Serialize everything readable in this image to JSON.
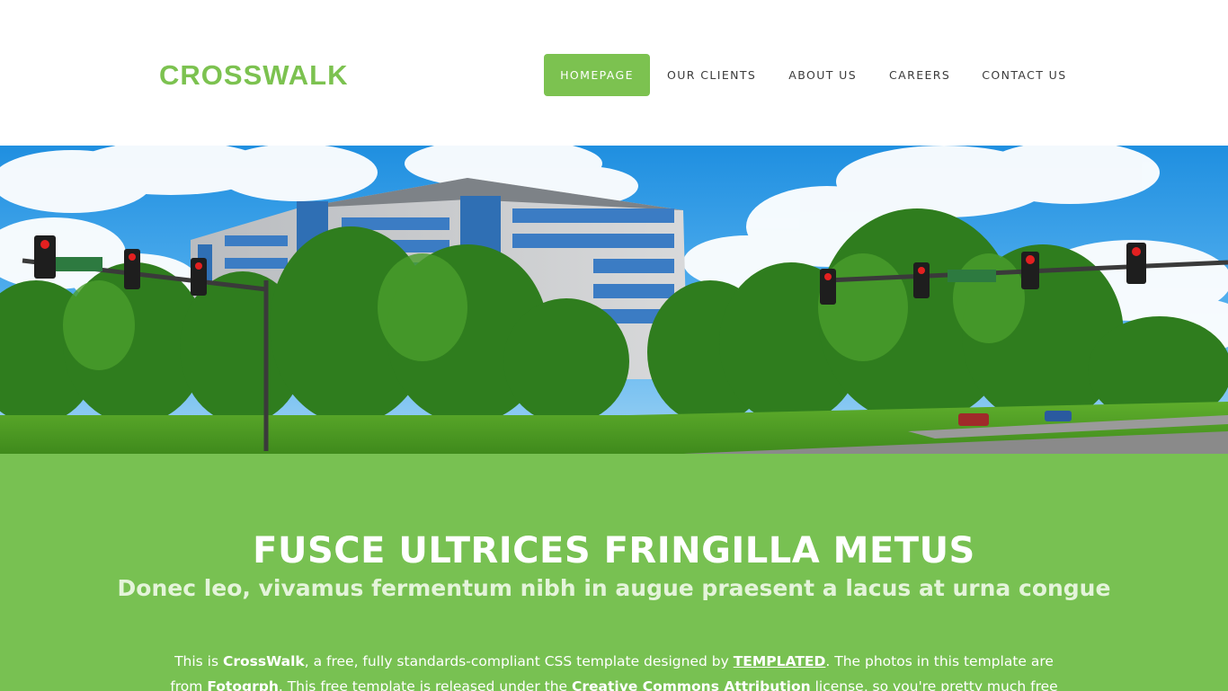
{
  "header": {
    "logo": "CROSSWALK",
    "nav": [
      {
        "label": "HOMEPAGE",
        "active": true
      },
      {
        "label": "OUR CLIENTS",
        "active": false
      },
      {
        "label": "ABOUT US",
        "active": false
      },
      {
        "label": "CAREERS",
        "active": false
      },
      {
        "label": "CONTACT US",
        "active": false
      }
    ]
  },
  "colors": {
    "accent": "#7cc250",
    "band": "#78c152",
    "text_dark": "#3b3b3b"
  },
  "banner": {
    "icon": "office-building-street-photo"
  },
  "intro": {
    "title": "FUSCE ULTRICES FRINGILLA METUS",
    "subtitle": "Donec leo, vivamus fermentum nibh in augue praesent a lacus at urna congue",
    "text": {
      "p1": "This is ",
      "brand": "CrossWalk",
      "p2": ", a free, fully standards-compliant CSS template designed by ",
      "link_templated": "TEMPLATED",
      "p3": ". The photos in this template are from ",
      "fotogrph": "Fotogrph",
      "p4": ". This free template is released under the ",
      "license": "Creative Commons Attribution",
      "p5": " license, so you're pretty much free to do whatever"
    }
  }
}
